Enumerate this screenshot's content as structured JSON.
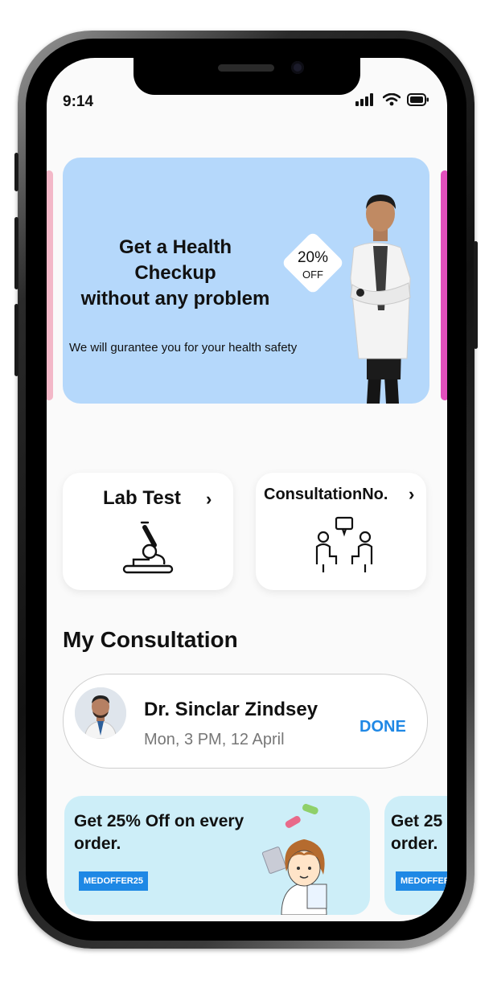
{
  "status": {
    "time": "9:14"
  },
  "banner": {
    "title_line1": "Get a Health",
    "title_line2": "Checkup",
    "title_line3": "without any problem",
    "subtitle": "We will gurantee you for your health safety",
    "offer_percent": "20%",
    "offer_label": "OFF",
    "color": "#b5d8fb"
  },
  "cards": [
    {
      "title": "Lab Test",
      "icon": "microscope-icon"
    },
    {
      "title": "ConsultationNo.",
      "icon": "consultation-icon"
    }
  ],
  "consultation": {
    "section_title": "My Consultation",
    "doctor_name": "Dr. Sinclar Zindsey",
    "time": "Mon, 3 PM, 12 April",
    "status": "DONE",
    "status_color": "#1f88e5"
  },
  "promos": [
    {
      "line1": "Get 25% Off on every",
      "line2": "order.",
      "code": "MEDOFFER25"
    },
    {
      "line1": "Get 25",
      "line2": "order.",
      "code": "MEDOFFER"
    }
  ]
}
